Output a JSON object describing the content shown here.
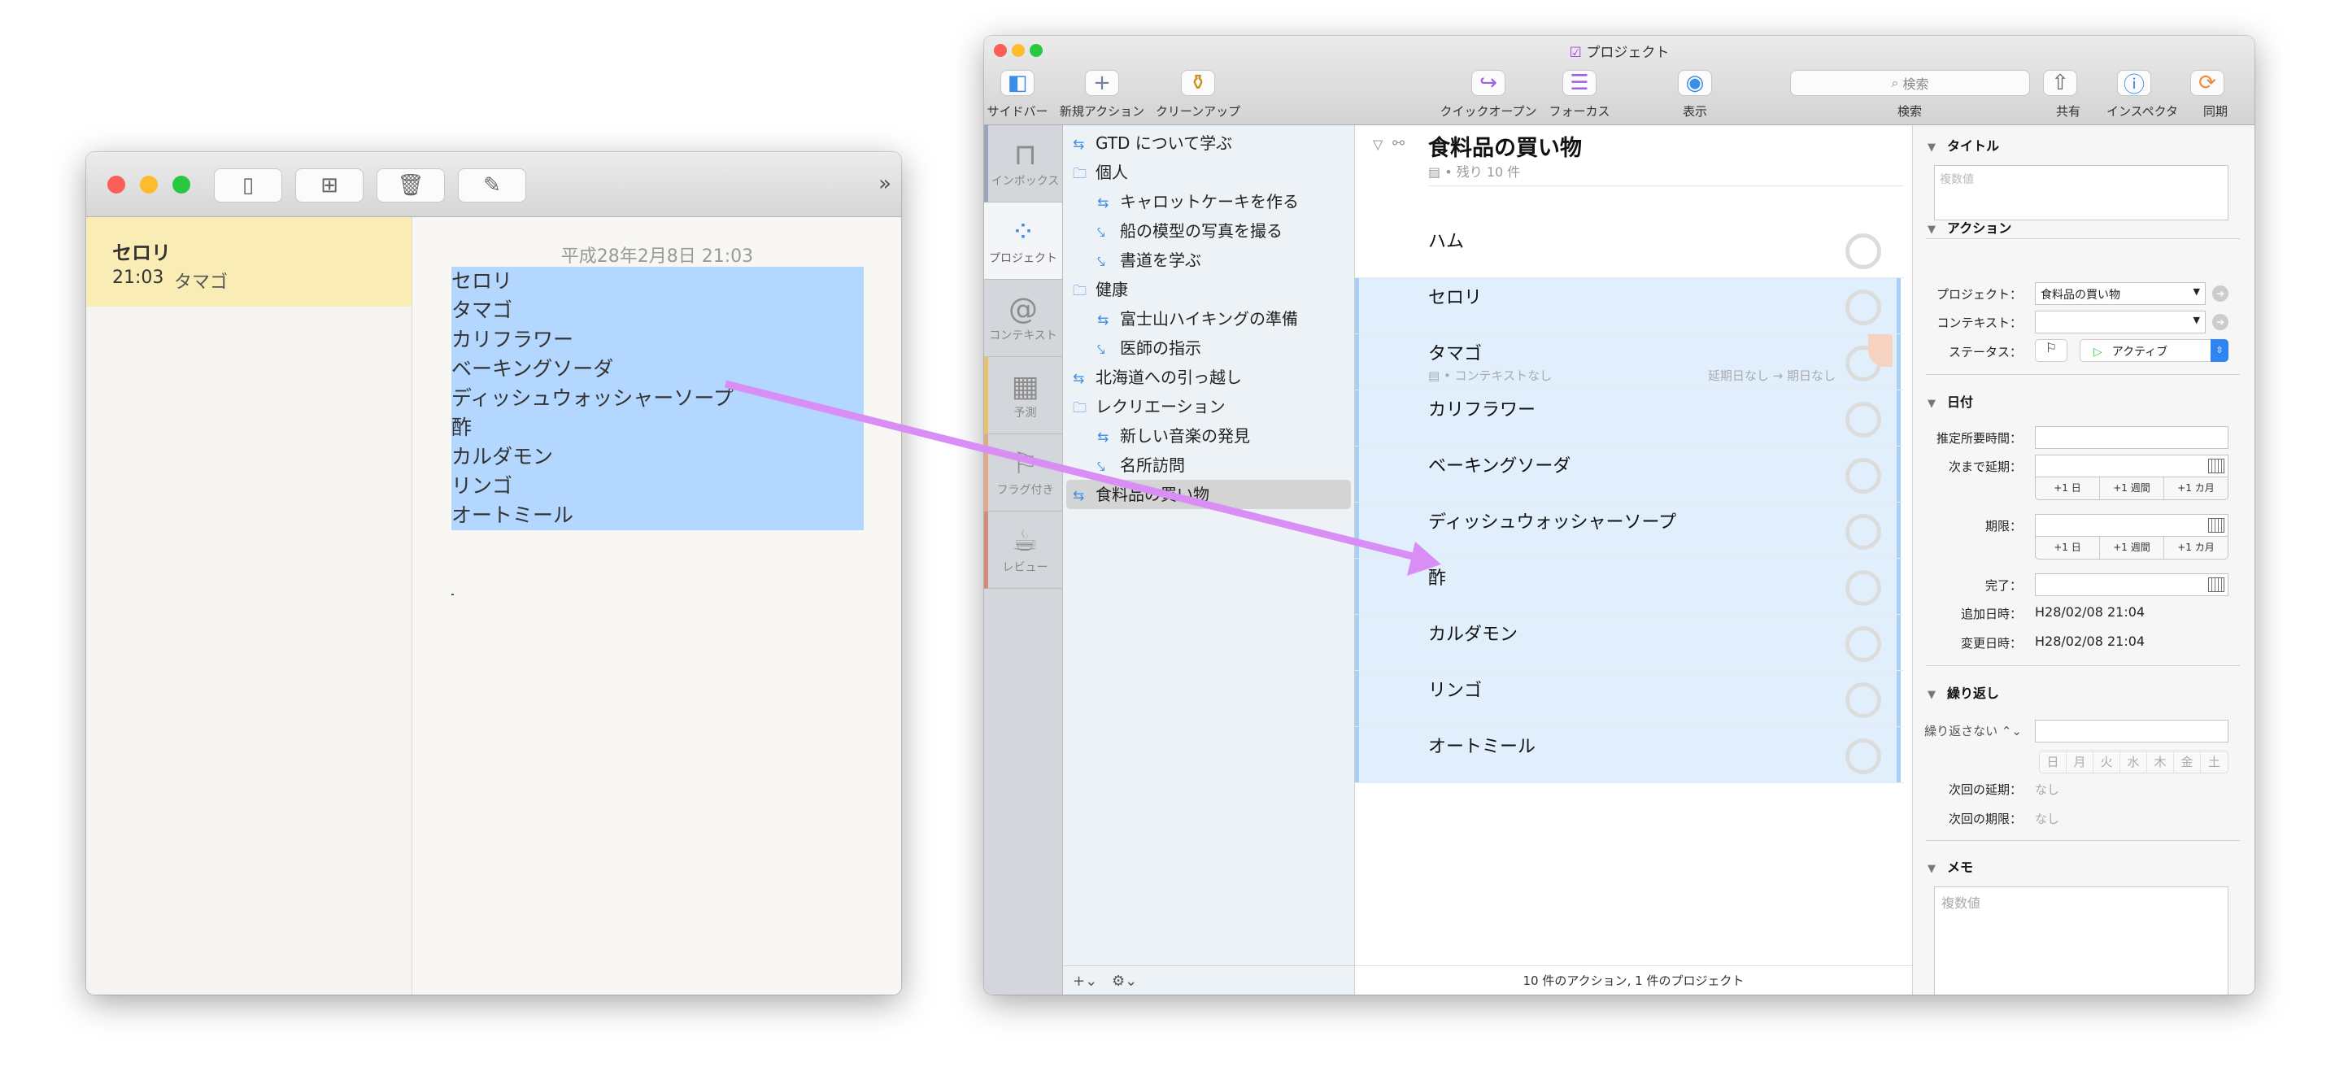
{
  "notes": {
    "toolbar_icons": [
      "sidebar-toggle-icon",
      "grid-icon",
      "trash-icon",
      "compose-icon"
    ],
    "overflow": "»",
    "list": [
      {
        "title": "セロリ",
        "time": "21:03",
        "preview": "タマゴ"
      }
    ],
    "date": "平成28年2月8日 21:03",
    "lines": [
      "セロリ",
      "タマゴ",
      "カリフラワー",
      "ベーキングソーダ",
      "ディッシュウォッシャーソープ",
      "酢",
      "カルダモン",
      "リンゴ",
      "オートミール"
    ],
    "selection_color": "#b3d7ff"
  },
  "omnifocus": {
    "window_title": "プロジェクト",
    "toolbar": {
      "sidebar": "サイドバー",
      "new_action": "新規アクション",
      "cleanup": "クリーンアップ",
      "quick_open": "クイックオープン",
      "focus": "フォーカス",
      "view": "表示",
      "search_placeholder": "検索",
      "search": "検索",
      "share": "共有",
      "inspector": "インスペクタ",
      "sync": "同期"
    },
    "tabs": [
      {
        "label": "インボックス",
        "icon": "inbox-icon"
      },
      {
        "label": "プロジェクト",
        "icon": "projects-icon"
      },
      {
        "label": "コンテキスト",
        "icon": "at-icon"
      },
      {
        "label": "予測",
        "icon": "forecast-icon"
      },
      {
        "label": "フラグ付き",
        "icon": "flag-icon"
      },
      {
        "label": "レビュー",
        "icon": "review-icon"
      }
    ],
    "projects": [
      {
        "label": "GTD について学ぶ",
        "type": "parallel",
        "level": 0
      },
      {
        "label": "個人",
        "type": "folder",
        "level": 0
      },
      {
        "label": "キャロットケーキを作る",
        "type": "parallel",
        "level": 1
      },
      {
        "label": "船の模型の写真を撮る",
        "type": "single",
        "level": 1
      },
      {
        "label": "書道を学ぶ",
        "type": "single",
        "level": 1
      },
      {
        "label": "健康",
        "type": "folder",
        "level": 0
      },
      {
        "label": "富士山ハイキングの準備",
        "type": "parallel",
        "level": 1
      },
      {
        "label": "医師の指示",
        "type": "single",
        "level": 1
      },
      {
        "label": "北海道への引っ越し",
        "type": "parallel",
        "level": 0
      },
      {
        "label": "レクリエーション",
        "type": "folder",
        "level": 0
      },
      {
        "label": "新しい音楽の発見",
        "type": "parallel",
        "level": 1
      },
      {
        "label": "名所訪問",
        "type": "single",
        "level": 1
      },
      {
        "label": "食料品の買い物",
        "type": "parallel",
        "level": 0,
        "selected": true
      }
    ],
    "sidebar_footer": {
      "add": "+⌄",
      "gear": "⚙⌄"
    },
    "main": {
      "project_title": "食料品の買い物",
      "project_meta": "▤ • 残り 10 件",
      "actions": [
        {
          "title": "ハム"
        },
        {
          "title": "セロリ",
          "selected": true
        },
        {
          "title": "タマゴ",
          "selected": true,
          "meta": "▤ • コンテキストなし",
          "dates": "延期日なし → 期日なし"
        },
        {
          "title": "カリフラワー",
          "selected": true
        },
        {
          "title": "ベーキングソーダ",
          "selected": true
        },
        {
          "title": "ディッシュウォッシャーソープ",
          "selected": true
        },
        {
          "title": "酢",
          "selected": true
        },
        {
          "title": "カルダモン",
          "selected": true
        },
        {
          "title": "リンゴ",
          "selected": true
        },
        {
          "title": "オートミール",
          "selected": true
        }
      ],
      "status": "10 件のアクション, 1 件のプロジェクト",
      "selection_color": "#e1effd"
    },
    "inspector": {
      "title_section": "タイトル",
      "title_placeholder": "複数値",
      "action_section": "アクション",
      "project_label": "プロジェクト：",
      "project_value": "食料品の買い物",
      "context_label": "コンテキスト：",
      "context_value": "",
      "status_label": "ステータス：",
      "status_value": "アクティブ",
      "date_section": "日付",
      "estimate_label": "推定所要時間：",
      "defer_label": "次まで延期：",
      "due_label": "期限：",
      "quick": [
        "+1 日",
        "+1 週間",
        "+1 カ月"
      ],
      "complete_label": "完了：",
      "added_label": "追加日時：",
      "added_value": "H28/02/08 21:04",
      "modified_label": "変更日時：",
      "modified_value": "H28/02/08 21:04",
      "repeat_section": "繰り返し",
      "repeat_value": "繰り返さない ⌃⌄",
      "weekdays": [
        "日",
        "月",
        "火",
        "水",
        "木",
        "金",
        "土"
      ],
      "next_defer_label": "次回の延期：",
      "next_defer_value": "なし",
      "next_due_label": "次回の期限：",
      "next_due_value": "なし",
      "memo_section": "メモ",
      "memo_placeholder": "複数値"
    }
  },
  "arrow_color": "#d98ef5"
}
